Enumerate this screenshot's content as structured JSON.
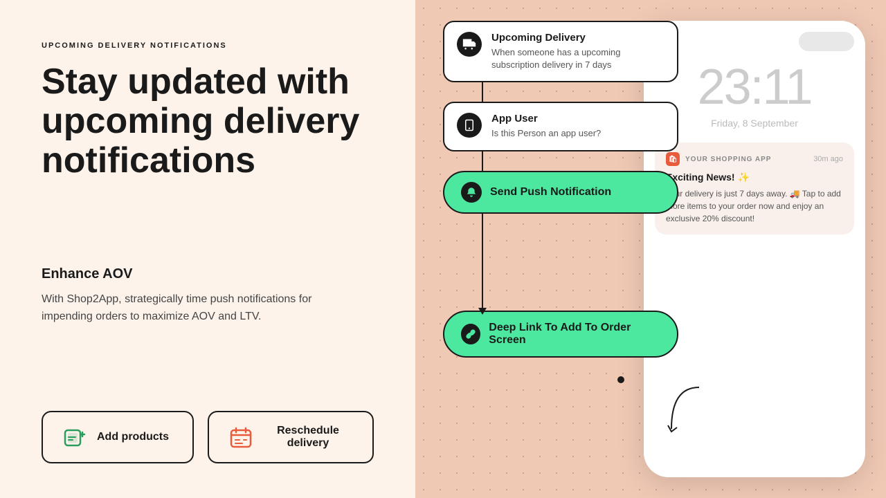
{
  "left": {
    "section_label": "UPCOMING DELIVERY NOTIFICATIONS",
    "main_heading": "Stay updated with upcoming delivery notifications",
    "enhance_title": "Enhance AOV",
    "enhance_description": "With Shop2App, strategically time push notifications for impending orders to maximize AOV and LTV.",
    "buttons": [
      {
        "id": "add-products",
        "label": "Add products"
      },
      {
        "id": "reschedule-delivery",
        "label": "Reschedule delivery"
      }
    ]
  },
  "right": {
    "flow": {
      "card1_title": "Upcoming Delivery",
      "card1_subtitle": "When someone has a upcoming subscription delivery in 7 days",
      "card2_title": "App User",
      "card2_subtitle": "Is this Person an app user?",
      "action_label": "Send Push Notification",
      "deep_link_label": "Deep Link To Add To Order Screen"
    },
    "phone": {
      "time": "23:11",
      "date": "Friday, 8 September",
      "notification": {
        "app_name": "YOUR SHOPPING APP",
        "time_ago": "30m ago",
        "title": "Exciting News! ✨",
        "body": "Your delivery is just 7 days away. 🚚 Tap to add more items to your order now and enjoy an exclusive 20% discount!"
      }
    }
  }
}
